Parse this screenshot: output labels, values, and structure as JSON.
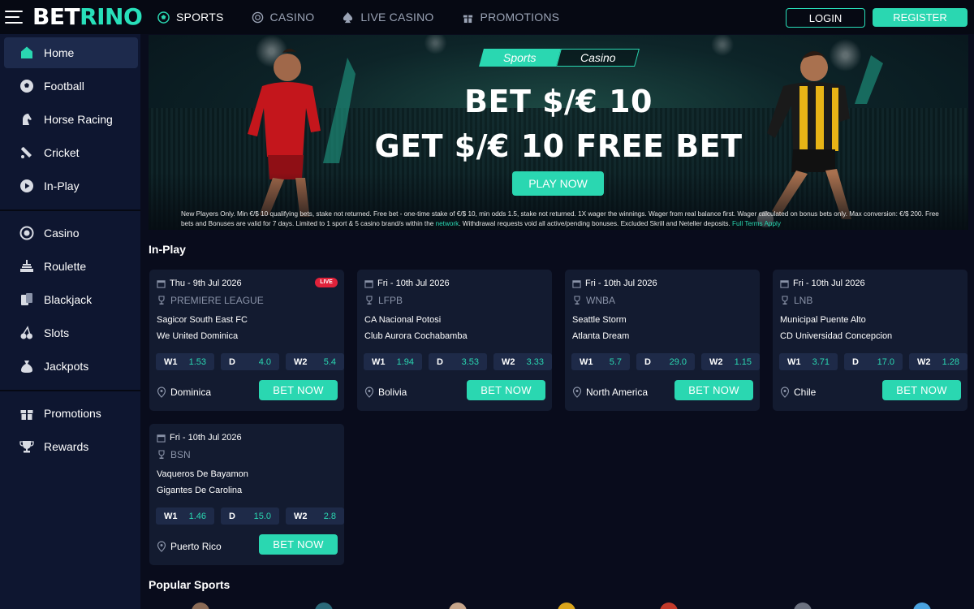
{
  "header": {
    "logo_bet": "BET",
    "logo_rino": "RINO",
    "nav": [
      {
        "label": "SPORTS",
        "active": true,
        "icon": "soccer-ball-icon"
      },
      {
        "label": "CASINO",
        "active": false,
        "icon": "casino-chip-icon"
      },
      {
        "label": "LIVE CASINO",
        "active": false,
        "icon": "spade-icon"
      },
      {
        "label": "PROMOTIONS",
        "active": false,
        "icon": "gift-icon"
      }
    ],
    "login_label": "LOGIN",
    "register_label": "REGISTER"
  },
  "sidebar": {
    "items": [
      {
        "label": "Home",
        "icon": "home-icon",
        "active": true
      },
      {
        "label": "Football",
        "icon": "football-icon"
      },
      {
        "label": "Horse Racing",
        "icon": "horse-icon"
      },
      {
        "label": "Cricket",
        "icon": "cricket-bat-icon"
      },
      {
        "label": "In-Play",
        "icon": "play-icon"
      },
      {
        "label": "Casino",
        "icon": "casino-chip-icon"
      },
      {
        "label": "Roulette",
        "icon": "roulette-icon"
      },
      {
        "label": "Blackjack",
        "icon": "cards-icon"
      },
      {
        "label": "Slots",
        "icon": "cherries-icon"
      },
      {
        "label": "Jackpots",
        "icon": "money-bag-icon"
      },
      {
        "label": "Promotions",
        "icon": "gift-icon"
      },
      {
        "label": "Rewards",
        "icon": "trophy-icon"
      }
    ]
  },
  "banner": {
    "tab_sports": "Sports",
    "tab_casino": "Casino",
    "headline1": "BET $/€ 10",
    "headline2": "GET $/€ 10 FREE BET",
    "cta": "PLAY NOW",
    "terms_a": "New Players Only. Min €/$ 10 qualifying bets, stake not returned. Free bet - one-time stake of €/$ 10, min odds 1.5, stake not returned. 1X wager the winnings. Wager from real balance first. Wager calculated on bonus bets only. Max conversion: €/$ 200. Free bets and Bonuses are valid for 7 days. Limited to 1 sport & 5 casino brand/s within the ",
    "terms_link": "network",
    "terms_b": ". Withdrawal requests void all active/pending bonuses. Excluded Skrill and Neteller deposits. ",
    "terms_full": "Full Terms Apply"
  },
  "inplay": {
    "title": "In-Play",
    "cards": [
      {
        "date": "Thu - 9th Jul 2026",
        "live": "LIVE",
        "league": "PREMIERE LEAGUE",
        "team1": "Sagicor South East FC",
        "team2": "We United Dominica",
        "odds": [
          {
            "k": "W1",
            "v": "1.53"
          },
          {
            "k": "D",
            "v": "4.0"
          },
          {
            "k": "W2",
            "v": "5.4"
          }
        ],
        "location": "Dominica",
        "bet": "BET NOW"
      },
      {
        "date": "Fri - 10th Jul 2026",
        "league": "LFPB",
        "team1": "CA Nacional Potosi",
        "team2": "Club Aurora Cochabamba",
        "odds": [
          {
            "k": "W1",
            "v": "1.94"
          },
          {
            "k": "D",
            "v": "3.53"
          },
          {
            "k": "W2",
            "v": "3.33"
          }
        ],
        "location": "Bolivia",
        "bet": "BET NOW"
      },
      {
        "date": "Fri - 10th Jul 2026",
        "league": "WNBA",
        "team1": "Seattle Storm",
        "team2": "Atlanta Dream",
        "odds": [
          {
            "k": "W1",
            "v": "5.7"
          },
          {
            "k": "D",
            "v": "29.0"
          },
          {
            "k": "W2",
            "v": "1.15"
          }
        ],
        "location": "North America",
        "bet": "BET NOW"
      },
      {
        "date": "Fri - 10th Jul 2026",
        "league": "LNB",
        "team1": "Municipal Puente Alto",
        "team2": "CD Universidad Concepcion",
        "odds": [
          {
            "k": "W1",
            "v": "3.71"
          },
          {
            "k": "D",
            "v": "17.0"
          },
          {
            "k": "W2",
            "v": "1.28"
          }
        ],
        "location": "Chile",
        "bet": "BET NOW"
      },
      {
        "date": "Fri - 10th Jul 2026",
        "league": "BSN",
        "team1": "Vaqueros De Bayamon",
        "team2": "Gigantes De Carolina",
        "odds": [
          {
            "k": "W1",
            "v": "1.46"
          },
          {
            "k": "D",
            "v": "15.0"
          },
          {
            "k": "W2",
            "v": "2.8"
          }
        ],
        "location": "Puerto Rico",
        "bet": "BET NOW"
      }
    ]
  },
  "popular": {
    "title": "Popular Sports"
  },
  "colors": {
    "accent": "#2ad7b1",
    "live": "#e0223a",
    "bg": "#090c1c",
    "card": "#131b30",
    "sidebar": "#0e1630"
  }
}
